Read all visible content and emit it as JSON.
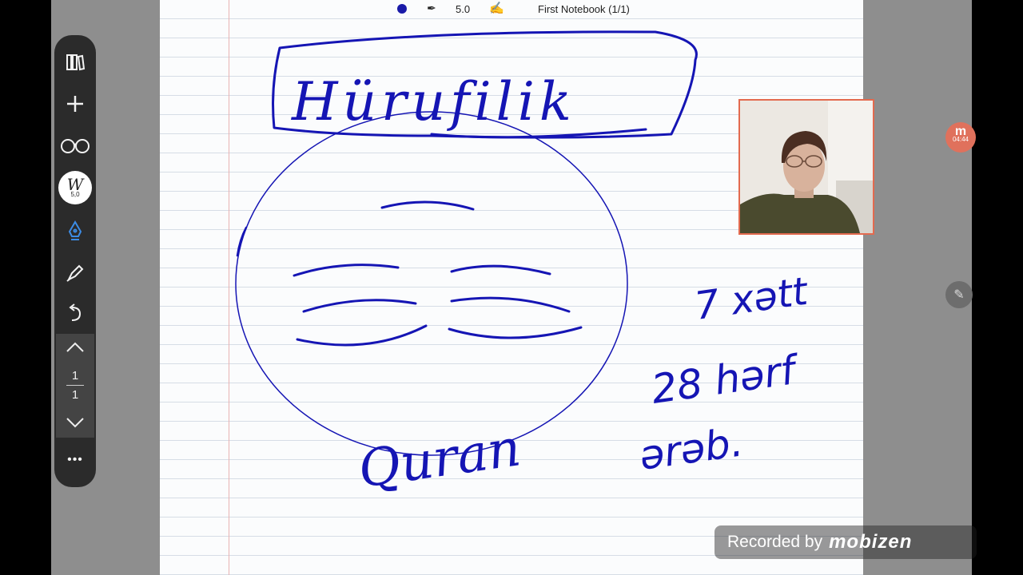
{
  "topbar": {
    "pen_size": "5.0",
    "notebook_title": "First Notebook (1/1)",
    "pen_color": "#1a1aa8"
  },
  "toolbar": {
    "icons": [
      "library-icon",
      "plus-icon",
      "glasses-icon",
      "pen-tool-icon",
      "fountain-pen-icon",
      "highlighter-icon",
      "undo-icon",
      "chevron-up-icon",
      "chevron-down-icon",
      "more-icon"
    ],
    "pen_tool_size": "5,0",
    "page_current": "1",
    "page_total": "1",
    "more_label": "•••"
  },
  "handwriting": {
    "title": "Hürufilik",
    "book": "Quran",
    "note_line1": "7 xətt",
    "note_line2": "28 hərf",
    "note_line3": "ərəb."
  },
  "recorder": {
    "badge_letter": "m",
    "elapsed": "04:44",
    "watermark_label": "Recorded by",
    "watermark_brand": "mobizen"
  }
}
